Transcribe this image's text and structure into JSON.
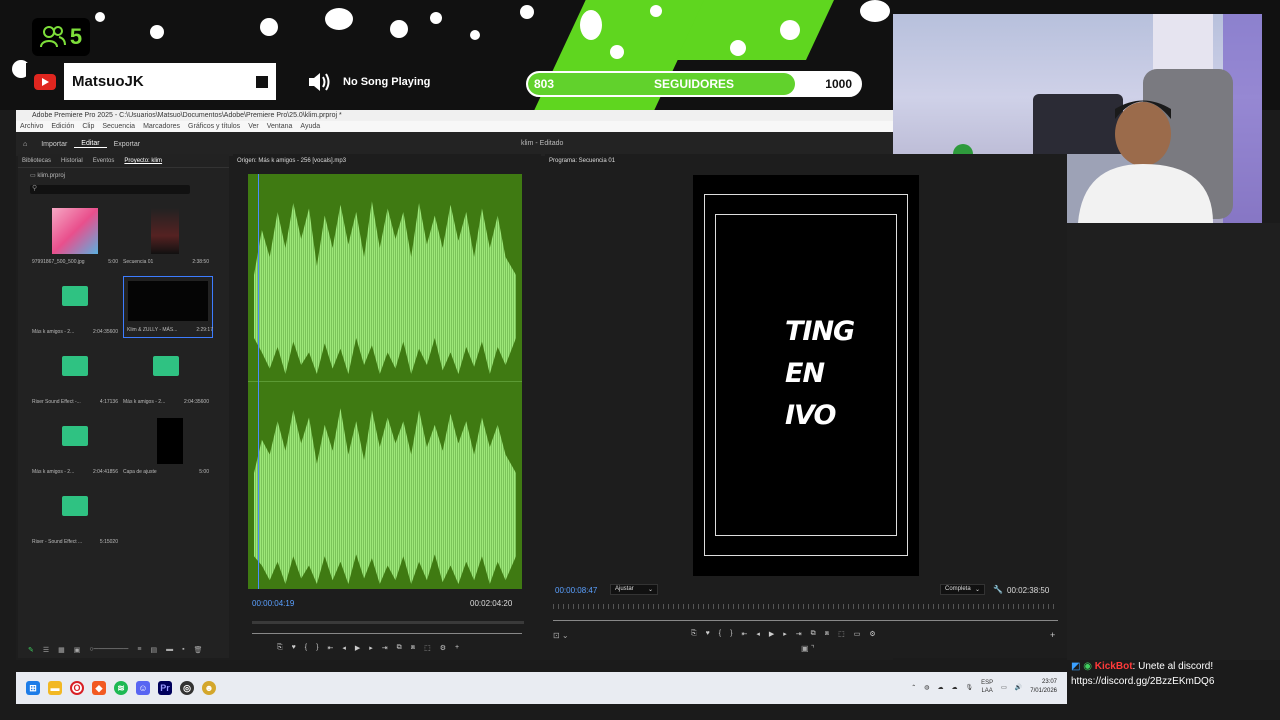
{
  "overlay": {
    "viewer_count": "5",
    "channel_name": "MatsuoJK",
    "song_status": "No Song Playing",
    "followers_goal": {
      "current": "803",
      "label": "SEGUIDORES",
      "target": "1000",
      "progress_fraction": 0.803
    }
  },
  "premiere": {
    "window_title": "Adobe Premiere Pro 2025 - C:\\Usuarios\\Matsuo\\Documentos\\Adobe\\Premiere Pro\\25.0\\klim.prproj *",
    "menu": [
      "Archivo",
      "Edición",
      "Clip",
      "Secuencia",
      "Marcadores",
      "Gráficos y títulos",
      "Ver",
      "Ventana",
      "Ayuda"
    ],
    "header_tabs": [
      "Importar",
      "Editar",
      "Exportar"
    ],
    "doc_title": "klim - Editado",
    "project_panel": {
      "tabs": [
        "Bibliotecas",
        "Historial",
        "Eventos",
        "Proyecto: klim"
      ],
      "project_file": "klim.prproj",
      "items": [
        {
          "name": "97991867_500_500.jpg",
          "duration": "5:00"
        },
        {
          "name": "Secuencia 01",
          "duration": "2:38:50"
        },
        {
          "name": "Más k amigos - 2...",
          "duration": "2:04:35600"
        },
        {
          "name": "Klim & ZULLY - MÁS...",
          "duration": "2:29:17"
        },
        {
          "name": "Riser Sound Effect -...",
          "duration": "4:17136"
        },
        {
          "name": "Más k amigos - 2...",
          "duration": "2:04:35600"
        },
        {
          "name": "Más k amigos - 2...",
          "duration": "2:04:41856"
        },
        {
          "name": "Capa de ajuste",
          "duration": "5:00"
        },
        {
          "name": "Riser - Sound Effect ...",
          "duration": "5:15020"
        }
      ]
    },
    "source_monitor": {
      "title": "Origen: Más k amigos - 256 [vocals].mp3",
      "timecode_current": "00:00:04:19",
      "timecode_duration": "00:02:04:20"
    },
    "program_monitor": {
      "title": "Programa: Secuencia 01",
      "text_lines": [
        "TING",
        "EN",
        "IVO"
      ],
      "timecode_current": "00:00:08:47",
      "fit": "Ajustar",
      "resolution": "Completa",
      "timecode_duration": "00:02:38:50"
    }
  },
  "taskbar": {
    "lang": "ESP",
    "lang_sub": "LAA",
    "time": "23:07",
    "date": "7/01/2026"
  },
  "chat": {
    "user": "KickBot",
    "message": ": Unete al discord!",
    "link": "https://discord.gg/2BzzEKmDQ6"
  },
  "colors": {
    "accent_green": "#5fd61f",
    "premiere_blue": "#5aa0ff",
    "waveform_bg": "#3f7a12"
  }
}
